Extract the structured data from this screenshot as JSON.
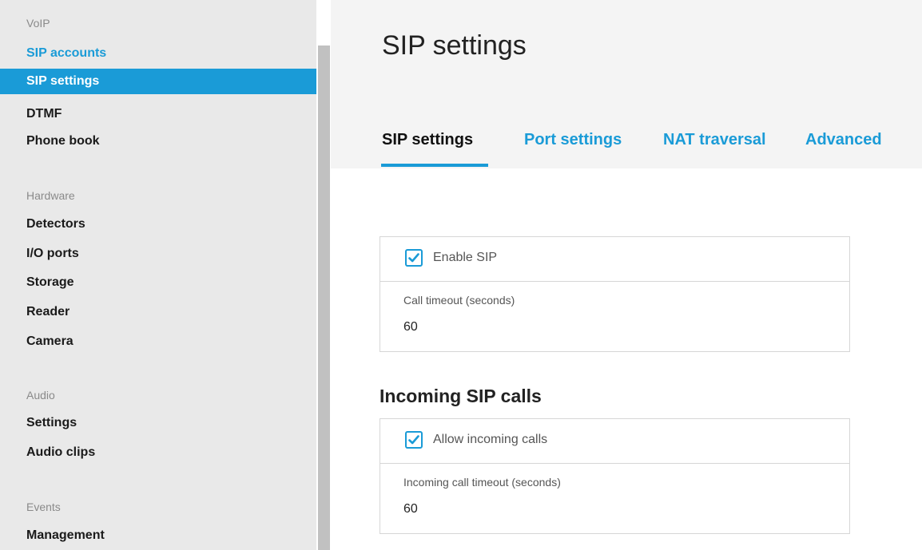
{
  "sidebar": {
    "sections": {
      "voip": "VoIP",
      "hardware": "Hardware",
      "audio": "Audio",
      "events": "Events"
    },
    "items": {
      "sip_accounts": "SIP accounts",
      "sip_settings": "SIP settings",
      "dtmf": "DTMF",
      "phone_book": "Phone book",
      "detectors": "Detectors",
      "io_ports": "I/O ports",
      "storage": "Storage",
      "reader": "Reader",
      "camera": "Camera",
      "settings": "Settings",
      "audio_clips": "Audio clips",
      "management": "Management"
    }
  },
  "main": {
    "title": "SIP settings",
    "tabs": {
      "sip_settings": "SIP settings",
      "port_settings": "Port settings",
      "nat_traversal": "NAT traversal",
      "advanced": "Advanced"
    },
    "sip_card": {
      "enable_label": "Enable SIP",
      "enable_checked": true,
      "timeout_label": "Call timeout (seconds)",
      "timeout_value": "60"
    },
    "incoming_heading": "Incoming SIP calls",
    "incoming_card": {
      "allow_label": "Allow incoming calls",
      "allow_checked": true,
      "timeout_label": "Incoming call timeout (seconds)",
      "timeout_value": "60"
    }
  },
  "colors": {
    "accent": "#1a9bd7",
    "sidebar_bg": "#e9e9e9",
    "header_bg": "#f4f4f4"
  }
}
